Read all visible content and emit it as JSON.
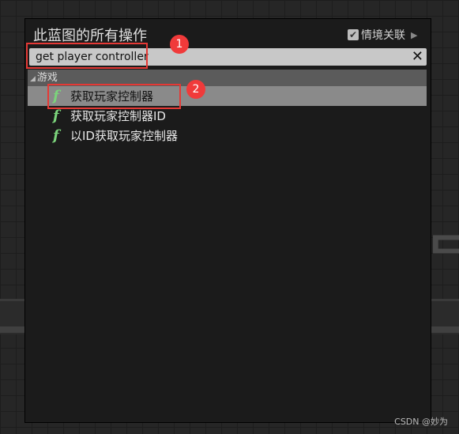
{
  "panel": {
    "title": "此蓝图的所有操作",
    "context_label": "情境关联",
    "context_checked": true
  },
  "search": {
    "value": "get player controller"
  },
  "category": {
    "label": "游戏"
  },
  "items": [
    {
      "label": "获取玩家控制器",
      "selected": true,
      "icon": "function-icon"
    },
    {
      "label": "获取玩家控制器ID",
      "selected": false,
      "icon": "function-icon"
    },
    {
      "label": "以ID获取玩家控制器",
      "selected": false,
      "icon": "function-icon"
    }
  ],
  "annotations": [
    "1",
    "2"
  ],
  "watermark": "CSDN @妙为",
  "colors": {
    "highlight": "#e53935",
    "function_icon": "#7bd37b"
  }
}
